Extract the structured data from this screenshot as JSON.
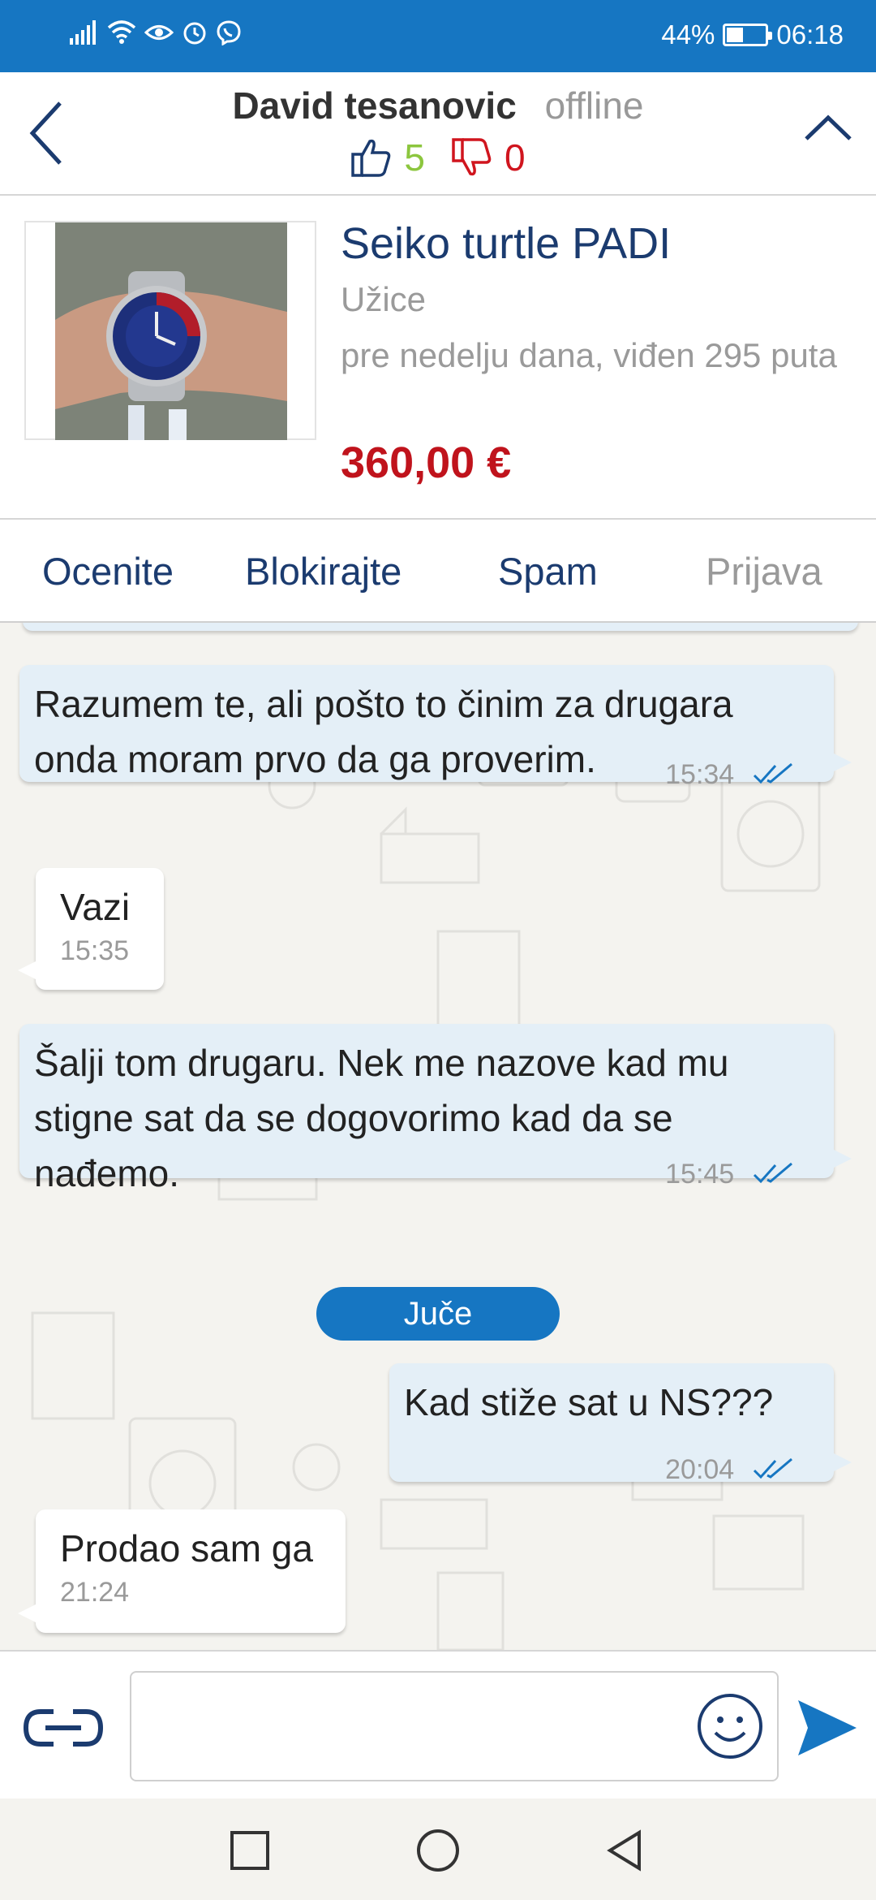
{
  "status_bar": {
    "battery_percent": "44%",
    "battery_level": 0.44,
    "time": "06:18",
    "icons": [
      "signal-icon",
      "wifi-icon",
      "eye-icon",
      "alarm-icon",
      "viber-icon"
    ]
  },
  "header": {
    "name": "David tesanovic",
    "status": "offline",
    "likes": "5",
    "dislikes": "0"
  },
  "product": {
    "title": "Seiko turtle PADI",
    "location": "Užice",
    "meta": "pre nedelju dana, viđen 295 puta",
    "price": "360,00 €"
  },
  "actions": {
    "rate": "Ocenite",
    "block": "Blokirajte",
    "spam": "Spam",
    "report": "Prijava"
  },
  "messages": [
    {
      "direction": "out",
      "line1": "Razumem te, ali pošto to činim za drugara",
      "line2": "onda moram prvo da ga proverim.",
      "time": "15:34"
    },
    {
      "direction": "in",
      "text": "Vazi",
      "time": "15:35"
    },
    {
      "direction": "out",
      "line1": "Šalji tom drugaru. Nek me nazove kad mu",
      "line2": "stigne sat da se dogovorimo kad da se",
      "line3": "nađemo.",
      "time": "15:45"
    },
    {
      "direction": "out",
      "text": "Kad stiže sat u NS???",
      "time": "20:04"
    },
    {
      "direction": "in",
      "text": "Prodao sam ga",
      "time": "21:24"
    }
  ],
  "date_divider": "Juče",
  "input": {
    "value": "",
    "placeholder": ""
  },
  "colors": {
    "brand_blue": "#1676c2",
    "navy_text": "#1b3b6f",
    "price_red": "#c0131c",
    "like_green": "#8cc63e",
    "dislike_red": "#d0151e",
    "outgoing_bubble": "#e4eff7"
  }
}
